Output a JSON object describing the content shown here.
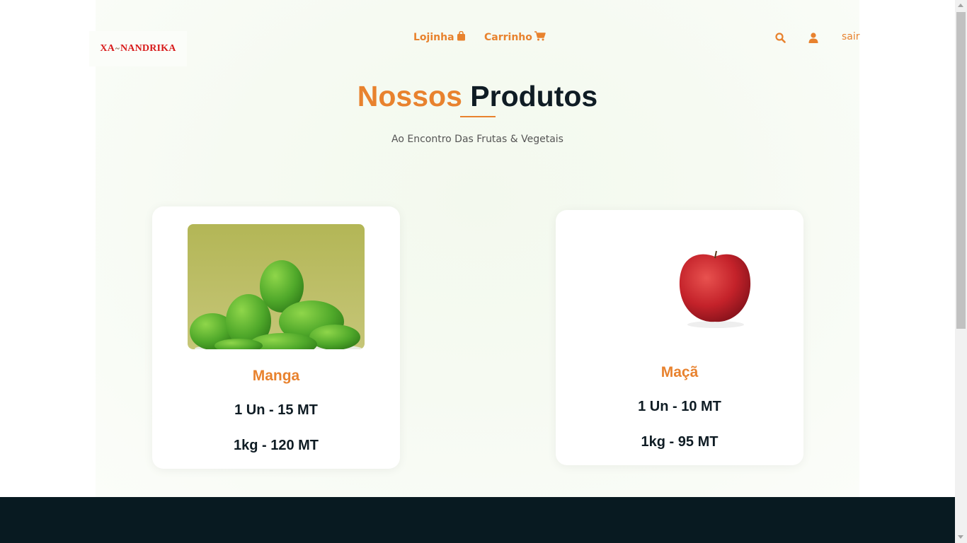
{
  "header": {
    "logo": {
      "left": "XA",
      "mid": "~",
      "right": "NANDRIKA"
    },
    "nav": [
      {
        "label": "Lojinha",
        "icon": "shopping-bag-icon"
      },
      {
        "label": "Carrinho",
        "icon": "cart-icon"
      }
    ],
    "actions": {
      "search_icon": "search-icon",
      "user_icon": "user-icon",
      "logout_label": "sair"
    }
  },
  "section": {
    "title_highlight": "Nossos",
    "title_rest": "Produtos",
    "subtitle": "Ao Encontro Das Frutas & Vegetais"
  },
  "products": [
    {
      "name": "Manga",
      "price_unit": "1 Un - 15 MT",
      "price_kg": "1kg - 120 MT",
      "image": "mangoes-photo"
    },
    {
      "name": "Maçã",
      "price_unit": "1 Un - 10 MT",
      "price_kg": "1kg - 95 MT",
      "image": "apple-photo"
    }
  ],
  "colors": {
    "accent": "#e8822e",
    "dark": "#0f1c24",
    "footer": "#081a21",
    "logo_red": "#d81a1a"
  }
}
